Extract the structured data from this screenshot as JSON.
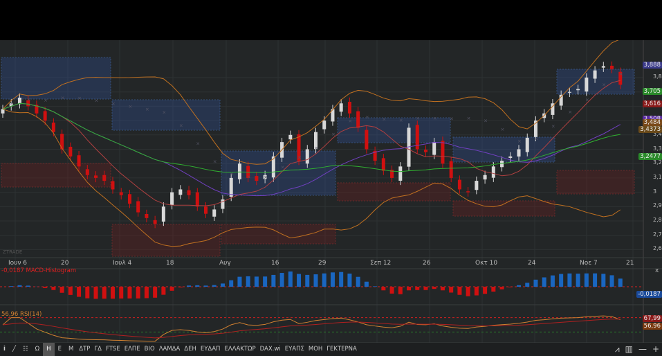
{
  "toolbar": {
    "info_icon": "info-icon",
    "draw_icon": "line-draw-icon",
    "grid_icon": "grid-icon",
    "periods": [
      "Ω",
      "Η",
      "Ε",
      "Μ"
    ],
    "active_period": "Η",
    "symbols": [
      "ΔΤΡ",
      "ΓΔ",
      "FTSE",
      "ΕΛΠΕ",
      "ΒΙΟ",
      "ΛΑΜΔΑ",
      "ΔΕΗ",
      "ΕΥΔΑΠ",
      "ΕΛΛΑΚΤΩΡ",
      "DAX.wi",
      "ΕΥΑΠΣ",
      "ΜΟΗ",
      "ΓΕΚΤΕΡΝΑ"
    ],
    "right_icons": [
      "chart-type-icon",
      "bar-chart-icon",
      "zoom-out-icon",
      "zoom-in-icon"
    ]
  },
  "watermark": "ZTRADE",
  "x_axis": [
    "Ιουν 6",
    "20",
    "Ιουλ 4",
    "18",
    "Αυγ",
    "16",
    "29",
    "Σεπ 12",
    "26",
    "Οκτ 10",
    "24",
    "Νοε 7",
    "21"
  ],
  "y_axis": [
    "3,8",
    "3,7",
    "3,6",
    "3,5",
    "3,4",
    "3,3",
    "3,2",
    "3,1",
    "3",
    "2,9",
    "2,8",
    "2,7",
    "2,6"
  ],
  "price_badges": [
    {
      "label": "3,888",
      "value": 3.888,
      "color": "#3a3a8a"
    },
    {
      "label": "3,705",
      "value": 3.705,
      "color": "#2a8a2a"
    },
    {
      "label": "3,616",
      "value": 3.616,
      "color": "#8a1a1a"
    },
    {
      "label": "3,508",
      "value": 3.508,
      "color": "#5a2aa0"
    },
    {
      "label": "3,484",
      "value": 3.484,
      "color": "#7a4a1a"
    },
    {
      "label": "3,4373",
      "value": 3.4373,
      "color": "#6a4a1a"
    },
    {
      "label": "3,2477",
      "value": 3.2477,
      "color": "#2a8a2a"
    }
  ],
  "macd": {
    "title": "-0,0187 MACD-Histogram",
    "value_label": "-0,0187",
    "close_label": "x"
  },
  "rsi": {
    "title": "56,96 RSI(14)",
    "badges": [
      "67,99",
      "56,96"
    ]
  },
  "chart_data": {
    "type": "candlestick",
    "closes": [
      3.58,
      3.62,
      3.66,
      3.6,
      3.55,
      3.5,
      3.42,
      3.3,
      3.25,
      3.18,
      3.12,
      3.1,
      3.08,
      3.02,
      2.98,
      2.92,
      2.86,
      2.82,
      2.78,
      2.9,
      3.0,
      3.02,
      2.98,
      2.9,
      2.85,
      2.88,
      2.95,
      3.1,
      3.2,
      3.1,
      3.08,
      3.12,
      3.25,
      3.35,
      3.4,
      3.22,
      3.3,
      3.42,
      3.5,
      3.58,
      3.62,
      3.55,
      3.45,
      3.3,
      3.22,
      3.15,
      3.1,
      3.18,
      3.45,
      3.3,
      3.28,
      3.35,
      3.2,
      3.1,
      3.02,
      3.0,
      3.08,
      3.12,
      3.18,
      3.22,
      3.25,
      3.3,
      3.38,
      3.5,
      3.55,
      3.62,
      3.68,
      3.7,
      3.72,
      3.8,
      3.85,
      3.88,
      3.86,
      3.75
    ],
    "ylim": [
      2.58,
      3.95
    ]
  }
}
